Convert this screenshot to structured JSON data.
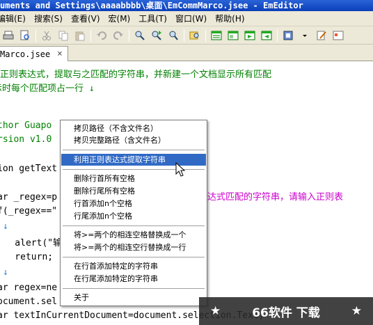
{
  "window": {
    "title": "uments and Settings\\aaaabbbb\\桌面\\EmCommMarco.jsee - EmEditor"
  },
  "menu": [
    "编辑(E)",
    "搜索(S)",
    "查看(V)",
    "宏(M)",
    "工具(T)",
    "窗口(W)",
    "帮助(H)"
  ],
  "tab": {
    "label": "Marco.jsee",
    "close": "×"
  },
  "editor": {
    "lines": [
      "用正则表达式，提取与之匹配的字符串，并新建一个文档显示所有匹配",
      "示时每个匹配项占一行 ↓",
      "",
      "thor Guapo",
      "rsion v1.0",
      "",
      "ion getText",
      "",
      "ar _regex=p",
      "f(_regex==\"",
      "↓",
      "    alert(\"输",
      "    return;",
      "↓",
      "ar regex=ne",
      "ocument.sel",
      "ar textInCurrentDocument=document.selection.Text;"
    ],
    "right_fragment": "达式匹配的字符串，请输入正则表"
  },
  "context_menu": {
    "items": [
      "拷贝路径（不含文件名）",
      "拷贝完整路径（含文件名）",
      "利用正则表达式提取字符串",
      "删除行首所有空格",
      "删除行尾所有空格",
      "行首添加n个空格",
      "行尾添加n个空格",
      "将>=两个的相连空格替换成一个",
      "将>=两个的相连空行替换成一行",
      "在行首添加特定的字符串",
      "在行尾添加特定的字符串",
      "关于"
    ],
    "selected_index": 2
  },
  "watermark": {
    "star_left": "★",
    "text": "66软件 下载",
    "star_right": "★"
  },
  "colors": {
    "title_bar": "#0a3fb8",
    "selection": "#316ac5",
    "comment": "#008000",
    "keyword": "#0000ff"
  }
}
